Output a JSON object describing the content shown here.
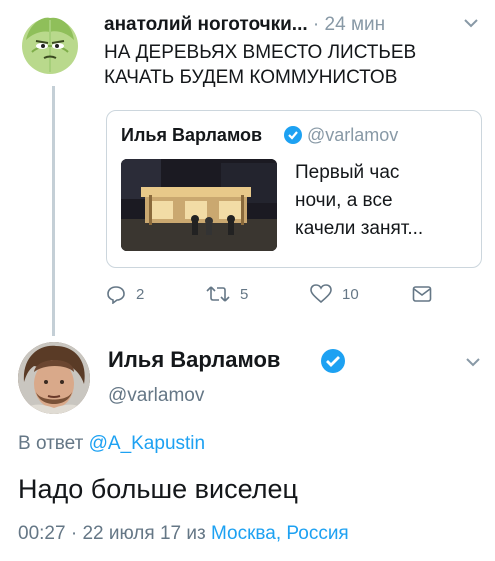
{
  "reply_tweet": {
    "author_name": "анатолий ноготочки...",
    "separator": "·",
    "time": "24 мин",
    "text": "НА ДЕРЕВЬЯХ ВМЕСТО ЛИСТЬЕВ\nКАЧАТЬ БУДЕМ КОММУНИСТОВ",
    "avatar_icon": "cabbage-avatar"
  },
  "quoted_tweet": {
    "author_name": "Илья Варламов",
    "handle": "@varlamov",
    "text": "Первый час\nночи, а все\nкачели занят...",
    "thumbnail_icon": "night-pavilion-photo"
  },
  "actions": {
    "reply_count": "2",
    "retweet_count": "5",
    "like_count": "10"
  },
  "main_tweet": {
    "author_name": "Илья Варламов",
    "handle": "@varlamov",
    "reply_prefix": "В ответ",
    "reply_to": "@A_Kapustin",
    "text": "Надо больше виселец",
    "time": "00:27",
    "meta_separator": "·",
    "date": "22 июля 17",
    "from_word": "из",
    "location": "Москва, Россия"
  },
  "colors": {
    "link": "#1da1f2",
    "secondary": "#657786",
    "verified": "#1da1f2"
  }
}
